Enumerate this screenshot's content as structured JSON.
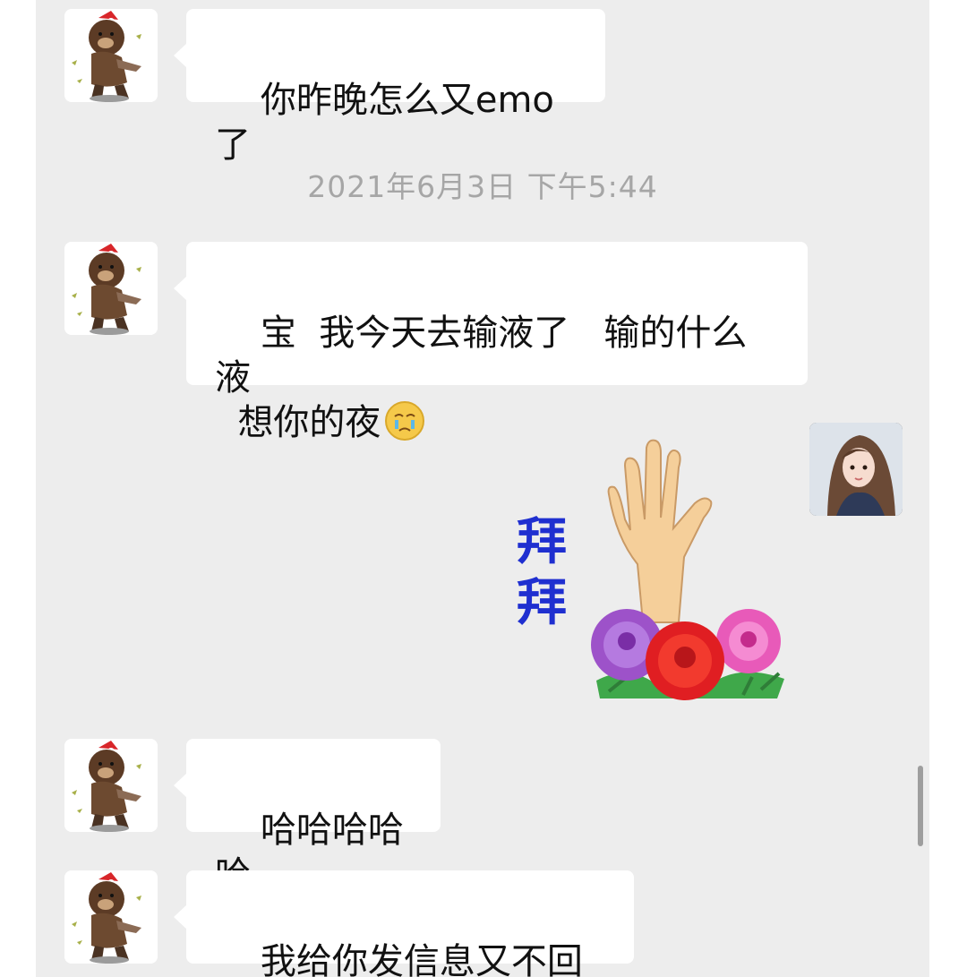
{
  "messages": [
    {
      "side": "left",
      "text": "你昨晚怎么又emo了"
    },
    {
      "side": "left",
      "text": "宝  我今天去输液了   输的什么液\n  想你的夜",
      "emoji": "crying-face-emoji"
    },
    {
      "side": "right",
      "sticker": "bye-bye-sticker",
      "sticker_text": [
        "拜",
        "拜"
      ]
    },
    {
      "side": "left",
      "text": "哈哈哈哈哈"
    },
    {
      "side": "left",
      "text": "我给你发信息又不回"
    }
  ],
  "timestamp": "2021年6月3日 下午5:44",
  "colors": {
    "chat_background": "#ededed",
    "bubble": "#ffffff",
    "timestamp_text": "#a6a6a6",
    "sticker_text": "#1f2fd0"
  }
}
